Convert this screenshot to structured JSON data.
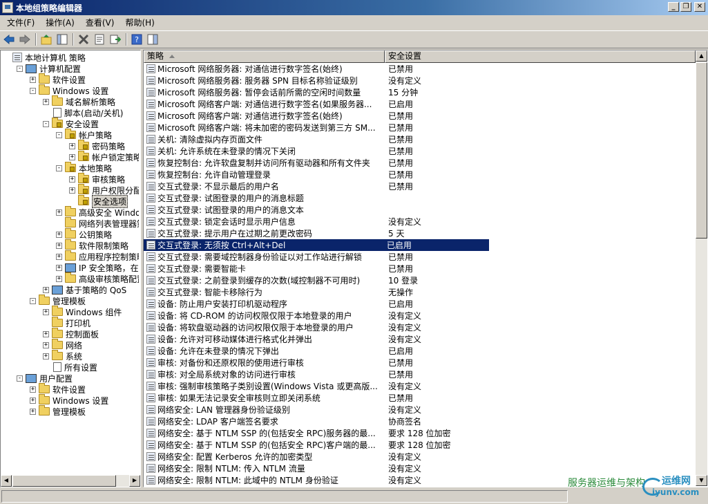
{
  "window": {
    "title": "本地组策略编辑器"
  },
  "menu": [
    "文件(F)",
    "操作(A)",
    "查看(V)",
    "帮助(H)"
  ],
  "tree": [
    {
      "label": "本地计算机 策略",
      "indent": 0,
      "exp": "",
      "icon": "policy"
    },
    {
      "label": "计算机配置",
      "indent": 1,
      "exp": "-",
      "icon": "computer"
    },
    {
      "label": "软件设置",
      "indent": 2,
      "exp": "+",
      "icon": "folder"
    },
    {
      "label": "Windows 设置",
      "indent": 2,
      "exp": "-",
      "icon": "folder"
    },
    {
      "label": "域名解析策略",
      "indent": 3,
      "exp": "+",
      "icon": "folder"
    },
    {
      "label": "脚本(启动/关机)",
      "indent": 3,
      "exp": "",
      "icon": "doc"
    },
    {
      "label": "安全设置",
      "indent": 3,
      "exp": "-",
      "icon": "lock"
    },
    {
      "label": "帐户策略",
      "indent": 4,
      "exp": "-",
      "icon": "lock"
    },
    {
      "label": "密码策略",
      "indent": 5,
      "exp": "+",
      "icon": "lock"
    },
    {
      "label": "帐户锁定策略",
      "indent": 5,
      "exp": "+",
      "icon": "lock"
    },
    {
      "label": "本地策略",
      "indent": 4,
      "exp": "-",
      "icon": "lock"
    },
    {
      "label": "审核策略",
      "indent": 5,
      "exp": "+",
      "icon": "lock"
    },
    {
      "label": "用户权限分配",
      "indent": 5,
      "exp": "+",
      "icon": "lock"
    },
    {
      "label": "安全选项",
      "indent": 5,
      "exp": "",
      "icon": "lock",
      "selected": true
    },
    {
      "label": "高级安全 Windows",
      "indent": 4,
      "exp": "+",
      "icon": "folder"
    },
    {
      "label": "网络列表管理器策略",
      "indent": 4,
      "exp": "",
      "icon": "folder"
    },
    {
      "label": "公钥策略",
      "indent": 4,
      "exp": "+",
      "icon": "folder"
    },
    {
      "label": "软件限制策略",
      "indent": 4,
      "exp": "+",
      "icon": "folder"
    },
    {
      "label": "应用程序控制策略",
      "indent": 4,
      "exp": "+",
      "icon": "folder"
    },
    {
      "label": "IP 安全策略，在 本",
      "indent": 4,
      "exp": "+",
      "icon": "computer"
    },
    {
      "label": "高级审核策略配置",
      "indent": 4,
      "exp": "+",
      "icon": "folder"
    },
    {
      "label": "基于策略的 QoS",
      "indent": 3,
      "exp": "+",
      "icon": "chart"
    },
    {
      "label": "管理模板",
      "indent": 2,
      "exp": "-",
      "icon": "folder"
    },
    {
      "label": "Windows 组件",
      "indent": 3,
      "exp": "+",
      "icon": "folder"
    },
    {
      "label": "打印机",
      "indent": 3,
      "exp": "",
      "icon": "folder"
    },
    {
      "label": "控制面板",
      "indent": 3,
      "exp": "+",
      "icon": "folder"
    },
    {
      "label": "网络",
      "indent": 3,
      "exp": "+",
      "icon": "folder"
    },
    {
      "label": "系统",
      "indent": 3,
      "exp": "+",
      "icon": "folder"
    },
    {
      "label": "所有设置",
      "indent": 3,
      "exp": "",
      "icon": "doc"
    },
    {
      "label": "用户配置",
      "indent": 1,
      "exp": "-",
      "icon": "user"
    },
    {
      "label": "软件设置",
      "indent": 2,
      "exp": "+",
      "icon": "folder"
    },
    {
      "label": "Windows 设置",
      "indent": 2,
      "exp": "+",
      "icon": "folder"
    },
    {
      "label": "管理模板",
      "indent": 2,
      "exp": "+",
      "icon": "folder"
    }
  ],
  "columns": {
    "policy": "策略",
    "setting": "安全设置"
  },
  "rows": [
    {
      "name": "Microsoft 网络服务器: 对通信进行数字签名(始终)",
      "setting": "已禁用"
    },
    {
      "name": "Microsoft 网络服务器: 服务器 SPN 目标名称验证级别",
      "setting": "没有定义"
    },
    {
      "name": "Microsoft 网络服务器: 暂停会话前所需的空闲时间数量",
      "setting": "15 分钟"
    },
    {
      "name": "Microsoft 网络客户端: 对通信进行数字签名(如果服务器...",
      "setting": "已启用"
    },
    {
      "name": "Microsoft 网络客户端: 对通信进行数字签名(始终)",
      "setting": "已禁用"
    },
    {
      "name": "Microsoft 网络客户端: 将未加密的密码发送到第三方 SM...",
      "setting": "已禁用"
    },
    {
      "name": "关机: 清除虚拟内存页面文件",
      "setting": "已禁用"
    },
    {
      "name": "关机: 允许系统在未登录的情况下关闭",
      "setting": "已禁用"
    },
    {
      "name": "恢复控制台: 允许软盘复制并访问所有驱动器和所有文件夹",
      "setting": "已禁用"
    },
    {
      "name": "恢复控制台: 允许自动管理登录",
      "setting": "已禁用"
    },
    {
      "name": "交互式登录: 不显示最后的用户名",
      "setting": "已禁用"
    },
    {
      "name": "交互式登录: 试图登录的用户的消息标题",
      "setting": ""
    },
    {
      "name": "交互式登录: 试图登录的用户的消息文本",
      "setting": ""
    },
    {
      "name": "交互式登录: 锁定会话时显示用户信息",
      "setting": "没有定义"
    },
    {
      "name": "交互式登录: 提示用户在过期之前更改密码",
      "setting": "5 天"
    },
    {
      "name": "交互式登录: 无须按 Ctrl+Alt+Del",
      "setting": "已启用",
      "selected": true
    },
    {
      "name": "交互式登录: 需要域控制器身份验证以对工作站进行解锁",
      "setting": "已禁用"
    },
    {
      "name": "交互式登录: 需要智能卡",
      "setting": "已禁用"
    },
    {
      "name": "交互式登录: 之前登录到缓存的次数(域控制器不可用时)",
      "setting": "10 登录"
    },
    {
      "name": "交互式登录: 智能卡移除行为",
      "setting": "无操作"
    },
    {
      "name": "设备: 防止用户安装打印机驱动程序",
      "setting": "已启用"
    },
    {
      "name": "设备: 将 CD-ROM 的访问权限仅限于本地登录的用户",
      "setting": "没有定义"
    },
    {
      "name": "设备: 将软盘驱动器的访问权限仅限于本地登录的用户",
      "setting": "没有定义"
    },
    {
      "name": "设备: 允许对可移动媒体进行格式化并弹出",
      "setting": "没有定义"
    },
    {
      "name": "设备: 允许在未登录的情况下弹出",
      "setting": "已启用"
    },
    {
      "name": "审核: 对备份和还原权限的使用进行审核",
      "setting": "已禁用"
    },
    {
      "name": "审核: 对全局系统对象的访问进行审核",
      "setting": "已禁用"
    },
    {
      "name": "审核: 强制审核策略子类别设置(Windows Vista 或更高版...",
      "setting": "没有定义"
    },
    {
      "name": "审核: 如果无法记录安全审核则立即关闭系统",
      "setting": "已禁用"
    },
    {
      "name": "网络安全: LAN 管理器身份验证级别",
      "setting": "没有定义"
    },
    {
      "name": "网络安全: LDAP 客户端签名要求",
      "setting": "协商签名"
    },
    {
      "name": "网络安全: 基于 NTLM SSP 的(包括安全 RPC)服务器的最...",
      "setting": "要求 128 位加密"
    },
    {
      "name": "网络安全: 基于 NTLM SSP 的(包括安全 RPC)客户端的最...",
      "setting": "要求 128 位加密"
    },
    {
      "name": "网络安全: 配置 Kerberos 允许的加密类型",
      "setting": "没有定义"
    },
    {
      "name": "网络安全: 限制 NTLM: 传入 NTLM 流量",
      "setting": "没有定义"
    },
    {
      "name": "网络安全: 限制 NTLM: 此域中的 NTLM 身份验证",
      "setting": "没有定义"
    }
  ],
  "watermark": {
    "text": "服务器运维与架构",
    "logo_top": "运维网",
    "logo_bottom": "iyunv.com"
  }
}
